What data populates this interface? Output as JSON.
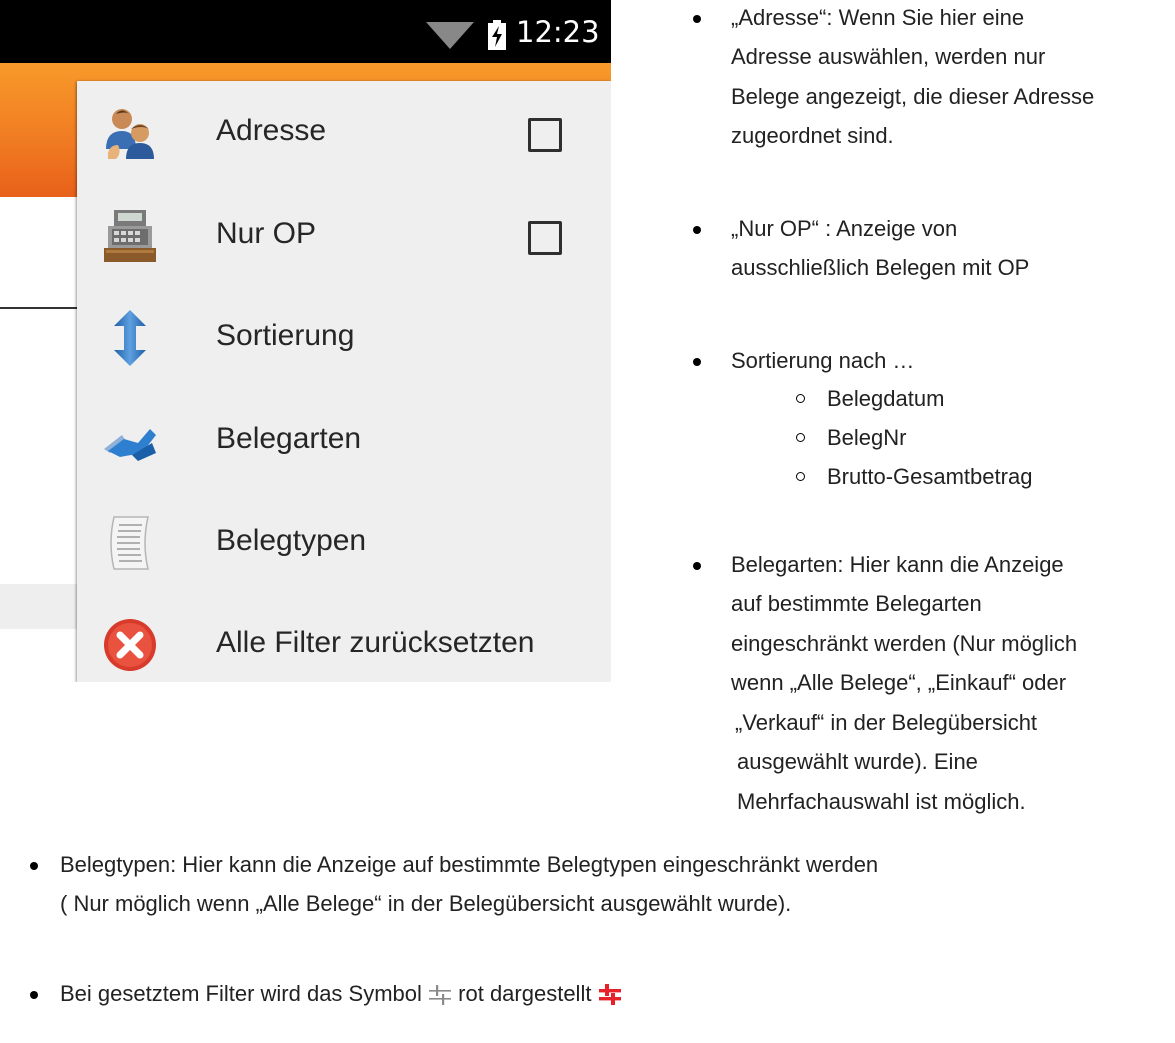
{
  "status_bar": {
    "time": "12:23",
    "icons": [
      "wifi-icon",
      "battery-charging-icon"
    ]
  },
  "app_bar": {
    "color": "#f07a22"
  },
  "filter_menu": {
    "items": [
      {
        "label": "Adresse",
        "icon": "people-icon",
        "has_checkbox": true,
        "checked": false
      },
      {
        "label": "Nur OP",
        "icon": "cash-register-icon",
        "has_checkbox": true,
        "checked": false
      },
      {
        "label": "Sortierung",
        "icon": "sort-arrows-icon",
        "has_checkbox": false
      },
      {
        "label": "Belegarten",
        "icon": "document-type-icon",
        "has_checkbox": false
      },
      {
        "label": "Belegtypen",
        "icon": "receipt-icon",
        "has_checkbox": false
      },
      {
        "label": "Alle Filter zurücksetzten",
        "icon": "reset-filter-icon",
        "has_checkbox": false
      }
    ]
  },
  "doc": {
    "adresse": [
      "„Adresse“: Wenn Sie hier eine",
      "Adresse auswählen, werden nur",
      "Belege angezeigt, die dieser Adresse",
      "zugeordnet sind."
    ],
    "nur_op": [
      "„Nur OP“ : Anzeige von",
      "ausschließlich Belegen mit OP"
    ],
    "sortierung": {
      "intro": "Sortierung nach …",
      "options": [
        "Belegdatum",
        "BelegNr",
        "Brutto-Gesamtbetrag"
      ]
    },
    "belegarten": [
      "Belegarten: Hier kann die Anzeige",
      "auf bestimmte Belegarten",
      "eingeschränkt werden (Nur möglich",
      "wenn „Alle Belege“, „Einkauf“ oder",
      "„Verkauf“ in der Belegübersicht",
      "ausgewählt wurde). Eine",
      "Mehrfachauswahl ist möglich."
    ],
    "belegtypen": [
      "Belegtypen: Hier kann die Anzeige auf bestimmte Belegtypen eingeschränkt werden",
      "( Nur möglich wenn „Alle Belege“  in der Belegübersicht ausgewählt wurde)."
    ],
    "filter_symbol": {
      "before": "Bei gesetztem Filter wird das Symbol",
      "middle": "rot dargestellt",
      "icon": "filter-sliders-icon",
      "normal_color": "#8a8a8a",
      "active_color": "#e8202a"
    }
  }
}
